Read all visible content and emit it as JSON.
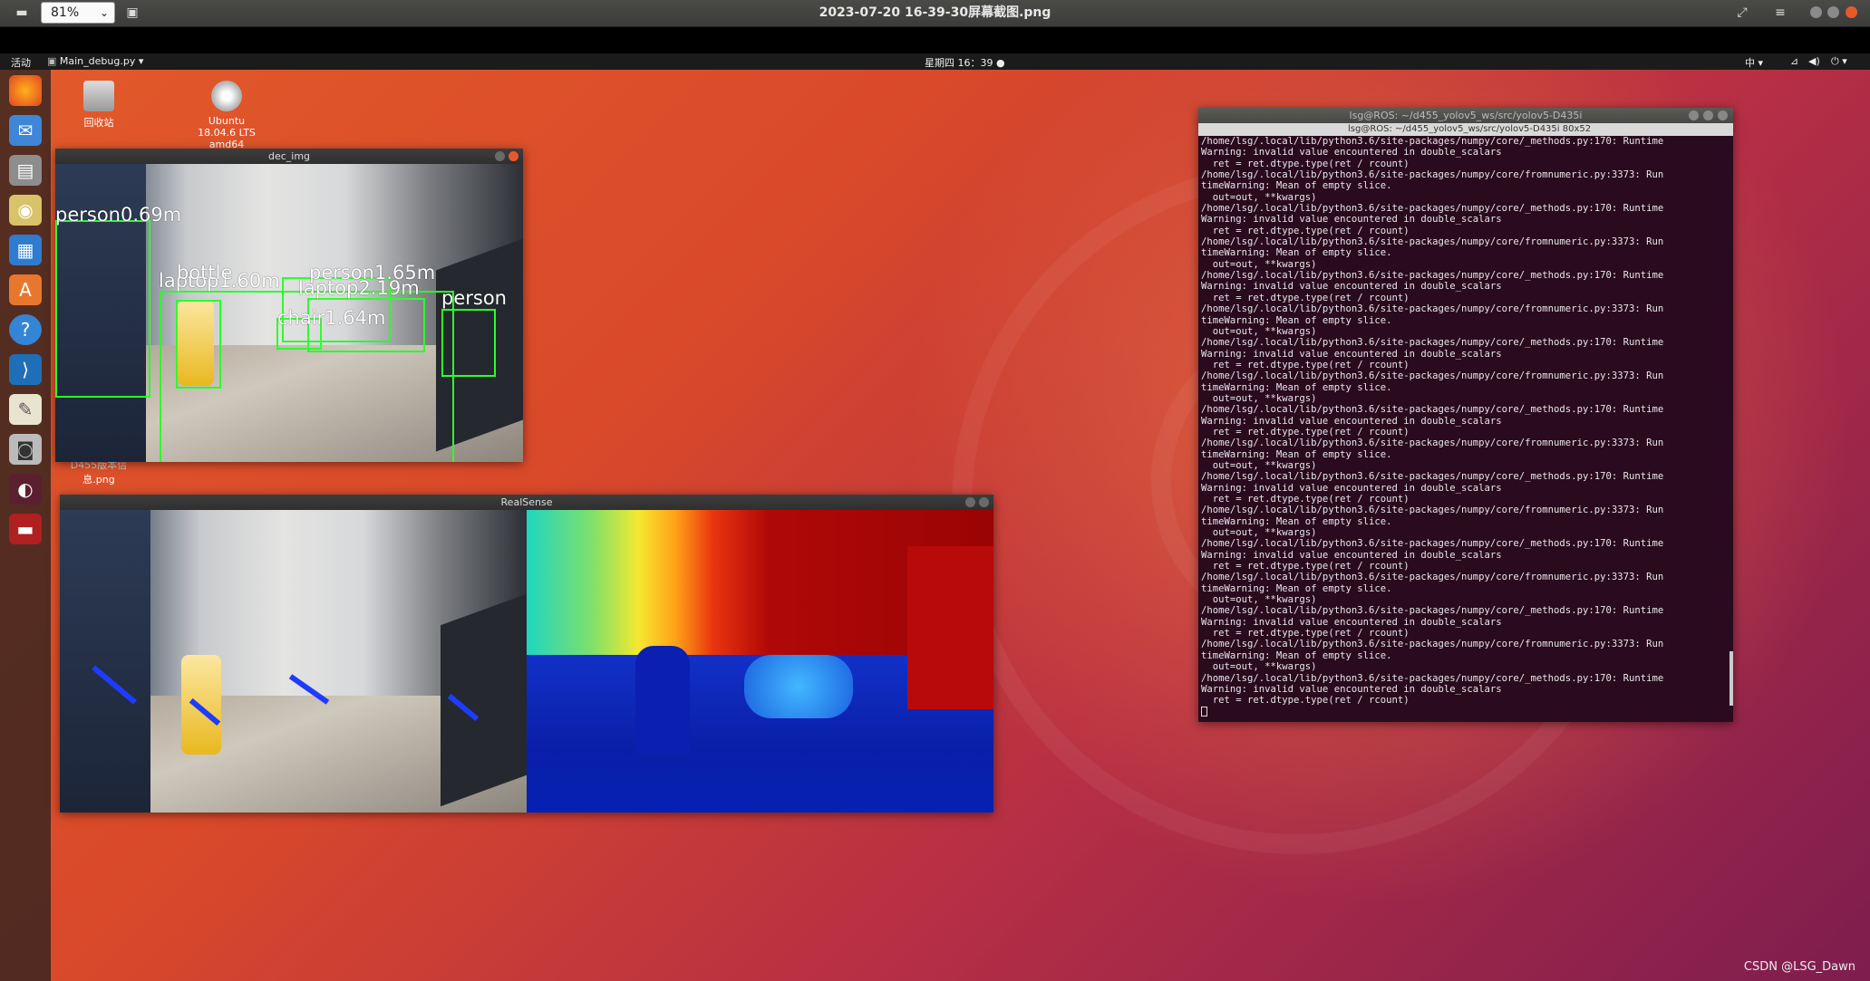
{
  "viewer": {
    "zoom": "81%",
    "title": "2023-07-20 16-39-30屏幕截图.png"
  },
  "topbar": {
    "activities": "活动",
    "app_menu": "Main_debug.py ▾",
    "clock": "星期四 16：39 ●",
    "input_method": "中 ▾"
  },
  "desktop_icons": {
    "trash": "回收站",
    "dvd_line1": "Ubuntu",
    "dvd_line2": "18.04.6 LTS",
    "dvd_line3": "amd64",
    "image_line1": "D455版本信",
    "image_line2": "息.png"
  },
  "windows": {
    "dec_img_title": "dec_img",
    "realsense_title": "RealSense",
    "terminal_title": "lsg@ROS: ~/d455_yolov5_ws/src/yolov5-D435i",
    "terminal_subtitle": "lsg@ROS: ~/d455_yolov5_ws/src/yolov5-D435i 80x52"
  },
  "detections": [
    {
      "label": "person0.69m"
    },
    {
      "label": "laptop1.60m"
    },
    {
      "label": "bottle"
    },
    {
      "label": "person1.65m"
    },
    {
      "label": "laptop2.19m"
    },
    {
      "label": "chair1.64m"
    },
    {
      "label": "person"
    }
  ],
  "terminal_lines": [
    "/home/lsg/.local/lib/python3.6/site-packages/numpy/core/_methods.py:170: Runtime",
    "Warning: invalid value encountered in double_scalars",
    "  ret = ret.dtype.type(ret / rcount)",
    "/home/lsg/.local/lib/python3.6/site-packages/numpy/core/fromnumeric.py:3373: Run",
    "timeWarning: Mean of empty slice.",
    "  out=out, **kwargs)",
    "/home/lsg/.local/lib/python3.6/site-packages/numpy/core/_methods.py:170: Runtime",
    "Warning: invalid value encountered in double_scalars",
    "  ret = ret.dtype.type(ret / rcount)",
    "/home/lsg/.local/lib/python3.6/site-packages/numpy/core/fromnumeric.py:3373: Run",
    "timeWarning: Mean of empty slice.",
    "  out=out, **kwargs)",
    "/home/lsg/.local/lib/python3.6/site-packages/numpy/core/_methods.py:170: Runtime",
    "Warning: invalid value encountered in double_scalars",
    "  ret = ret.dtype.type(ret / rcount)",
    "/home/lsg/.local/lib/python3.6/site-packages/numpy/core/fromnumeric.py:3373: Run",
    "timeWarning: Mean of empty slice.",
    "  out=out, **kwargs)",
    "/home/lsg/.local/lib/python3.6/site-packages/numpy/core/_methods.py:170: Runtime",
    "Warning: invalid value encountered in double_scalars",
    "  ret = ret.dtype.type(ret / rcount)",
    "/home/lsg/.local/lib/python3.6/site-packages/numpy/core/fromnumeric.py:3373: Run",
    "timeWarning: Mean of empty slice.",
    "  out=out, **kwargs)",
    "/home/lsg/.local/lib/python3.6/site-packages/numpy/core/_methods.py:170: Runtime",
    "Warning: invalid value encountered in double_scalars",
    "  ret = ret.dtype.type(ret / rcount)",
    "/home/lsg/.local/lib/python3.6/site-packages/numpy/core/fromnumeric.py:3373: Run",
    "timeWarning: Mean of empty slice.",
    "  out=out, **kwargs)",
    "/home/lsg/.local/lib/python3.6/site-packages/numpy/core/_methods.py:170: Runtime",
    "Warning: invalid value encountered in double_scalars",
    "  ret = ret.dtype.type(ret / rcount)",
    "/home/lsg/.local/lib/python3.6/site-packages/numpy/core/fromnumeric.py:3373: Run",
    "timeWarning: Mean of empty slice.",
    "  out=out, **kwargs)",
    "/home/lsg/.local/lib/python3.6/site-packages/numpy/core/_methods.py:170: Runtime",
    "Warning: invalid value encountered in double_scalars",
    "  ret = ret.dtype.type(ret / rcount)",
    "/home/lsg/.local/lib/python3.6/site-packages/numpy/core/fromnumeric.py:3373: Run",
    "timeWarning: Mean of empty slice.",
    "  out=out, **kwargs)",
    "/home/lsg/.local/lib/python3.6/site-packages/numpy/core/_methods.py:170: Runtime",
    "Warning: invalid value encountered in double_scalars",
    "  ret = ret.dtype.type(ret / rcount)",
    "/home/lsg/.local/lib/python3.6/site-packages/numpy/core/fromnumeric.py:3373: Run",
    "timeWarning: Mean of empty slice.",
    "  out=out, **kwargs)",
    "/home/lsg/.local/lib/python3.6/site-packages/numpy/core/_methods.py:170: Runtime",
    "Warning: invalid value encountered in double_scalars",
    "  ret = ret.dtype.type(ret / rcount)"
  ],
  "watermark": "CSDN @LSG_Dawn",
  "colors": {
    "detection_box": "#2cff2c",
    "window_close": "#e65a2a",
    "terminal_bg": "#2a0a1e"
  }
}
